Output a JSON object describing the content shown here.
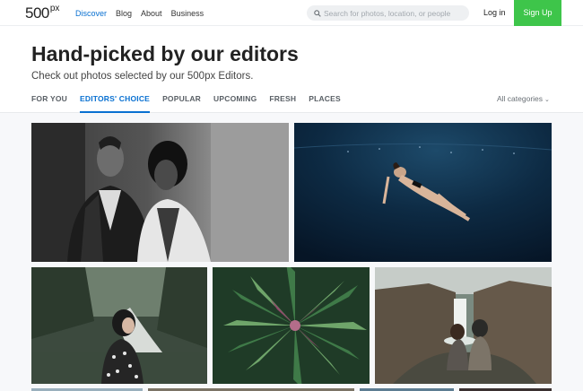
{
  "brand": {
    "logo_main": "500",
    "logo_sup": "px"
  },
  "nav": {
    "discover": "Discover",
    "blog": "Blog",
    "about": "About",
    "business": "Business"
  },
  "search": {
    "placeholder": "Search for photos, location, or people"
  },
  "auth": {
    "login": "Log in",
    "signup": "Sign Up"
  },
  "header": {
    "title": "Hand-picked by our editors",
    "subtitle": "Check out photos selected by our 500px Editors."
  },
  "tabs": [
    "FOR YOU",
    "EDITORS' CHOICE",
    "POPULAR",
    "UPCOMING",
    "FRESH",
    "PLACES"
  ],
  "active_tab": "EDITORS' CHOICE",
  "categories": {
    "label": "All categories"
  },
  "colors": {
    "accent": "#0870d1",
    "signup_green": "#3ec54a"
  }
}
